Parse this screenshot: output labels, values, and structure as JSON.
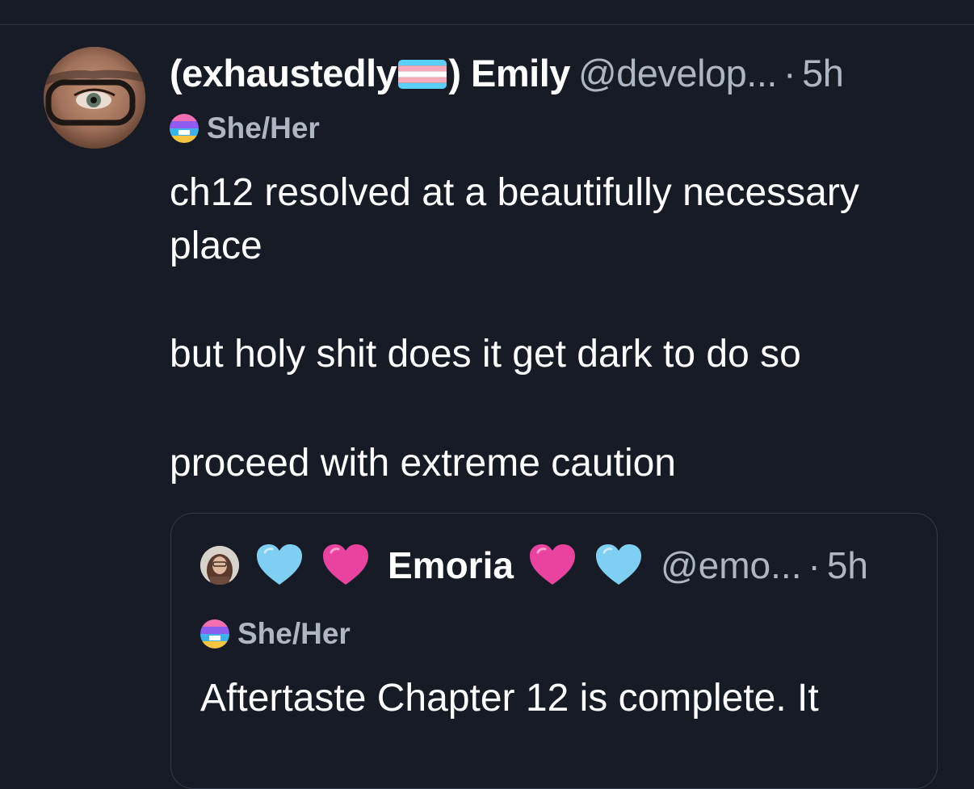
{
  "post": {
    "display_name_prefix": "(exhaustedly",
    "display_name_suffix": ") Emily",
    "flag_icon": "trans-flag-icon",
    "handle": "@develop...",
    "separator": "·",
    "time": "5h",
    "pronouns": "She/Her",
    "text_paragraphs": [
      "ch12 resolved at a beautifully necessary place",
      "but holy shit does it get dark to do so",
      "proceed with extreme caution"
    ]
  },
  "quote": {
    "display_name": "Emoria",
    "hearts": [
      "light-blue-heart-icon",
      "pink-heart-icon",
      "pink-heart-icon",
      "light-blue-heart-icon"
    ],
    "handle": "@emo...",
    "separator": "·",
    "time": "5h",
    "pronouns": "She/Her",
    "text": "Aftertaste Chapter 12 is complete. It"
  },
  "colors": {
    "background": "#161b26",
    "secondary_text": "#aeb6c3",
    "border": "#323a49",
    "heart_blue": "#7fcff3",
    "heart_pink": "#e8439f"
  }
}
